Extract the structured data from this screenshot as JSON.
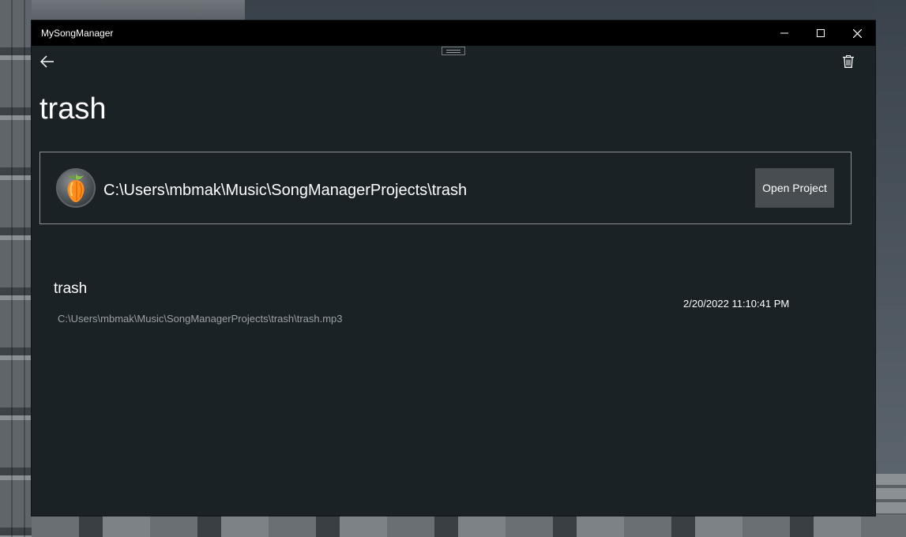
{
  "window": {
    "title": "MySongManager"
  },
  "page": {
    "title": "trash"
  },
  "project": {
    "path": "C:\\Users\\mbmak\\Music\\SongManagerProjects\\trash",
    "open_label": "Open Project",
    "logo_icon": "fl-studio-logo-icon"
  },
  "songs": [
    {
      "name": "trash",
      "path": "C:\\Users\\mbmak\\Music\\SongManagerProjects\\trash\\trash.mp3",
      "date": "2/20/2022 11:10:41 PM"
    }
  ],
  "icons": {
    "back": "back-arrow-icon",
    "delete": "trash-can-icon",
    "minimize": "minimize-icon",
    "maximize": "maximize-icon",
    "close": "close-icon"
  },
  "colors": {
    "app_background": "#1b2226",
    "titlebar": "#000000",
    "button_background": "#474d51",
    "secondary_text": "#9aa1a5"
  }
}
